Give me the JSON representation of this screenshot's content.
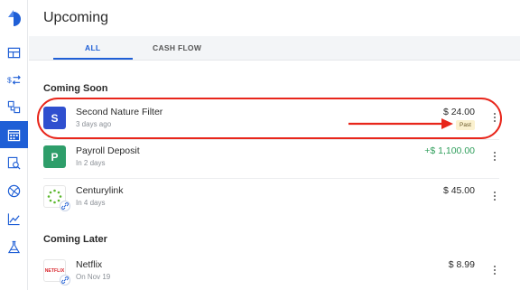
{
  "page": {
    "title": "Upcoming"
  },
  "tabs": [
    {
      "label": "ALL",
      "active": true
    },
    {
      "label": "CASH FLOW",
      "active": false
    }
  ],
  "sidebar": {
    "items": [
      {
        "icon": "dashboard-icon",
        "active": false
      },
      {
        "icon": "transfer-icon",
        "active": false
      },
      {
        "icon": "categories-icon",
        "active": false
      },
      {
        "icon": "calendar-icon",
        "active": true
      },
      {
        "icon": "report-search-icon",
        "active": false
      },
      {
        "icon": "dribbble-icon",
        "active": false
      },
      {
        "icon": "chart-line-icon",
        "active": false
      },
      {
        "icon": "flask-icon",
        "active": false
      }
    ]
  },
  "sections": {
    "coming_soon": {
      "title": "Coming Soon",
      "rows": [
        {
          "name": "Second Nature Filter",
          "sub": "3 days ago",
          "amount": "$ 24.00",
          "badge": "Past",
          "avatar_letter": "S",
          "avatar_color": "#2f4fcf"
        },
        {
          "name": "Payroll Deposit",
          "sub": "In 2 days",
          "amount": "+$ 1,100.00",
          "avatar_letter": "P",
          "avatar_color": "#2e9e6a"
        },
        {
          "name": "Centurylink",
          "sub": "In 4 days",
          "amount": "$ 45.00"
        }
      ]
    },
    "coming_later": {
      "title": "Coming Later",
      "rows": [
        {
          "name": "Netflix",
          "sub": "On Nov 19",
          "amount": "$ 8.99",
          "logo_text": "NETFLIX"
        }
      ]
    }
  },
  "colors": {
    "accent": "#1f5fd6",
    "positive": "#2f9e5b",
    "annotation": "#e8261b"
  }
}
